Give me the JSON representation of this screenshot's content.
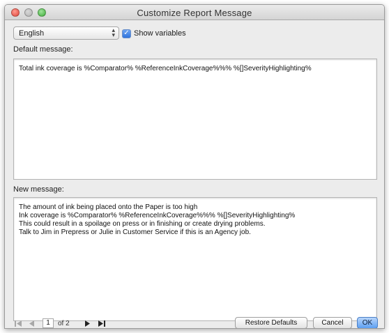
{
  "window": {
    "title": "Customize Report Message"
  },
  "toolbar": {
    "language_selected": "English",
    "show_variables_label": "Show variables",
    "show_variables_checked": true
  },
  "default_message": {
    "label": "Default message:",
    "text": "Total ink coverage is %Comparator% %ReferenceInkCoverage%%% %[]SeverityHighlighting%"
  },
  "new_message": {
    "label": "New message:",
    "text": "The amount of ink being placed onto the Paper is too high\nInk coverage is %Comparator% %ReferenceInkCoverage%%% %[]SeverityHighlighting%\nThis could result in a spoilage on press or in finishing or create drying problems.\nTalk to Jim in Prepress or Julie in Customer Service if this is an Agency job."
  },
  "pager": {
    "current_page": "1",
    "of_text": "of 2",
    "first_icon": "first-page-icon",
    "prev_icon": "previous-page-icon",
    "next_icon": "next-page-icon",
    "last_icon": "last-page-icon"
  },
  "buttons": {
    "restore_defaults": "Restore Defaults",
    "cancel": "Cancel",
    "ok": "OK"
  },
  "colors": {
    "accent": "#5c9ff2",
    "close": "#e0443a",
    "zoom": "#3fae3a"
  }
}
